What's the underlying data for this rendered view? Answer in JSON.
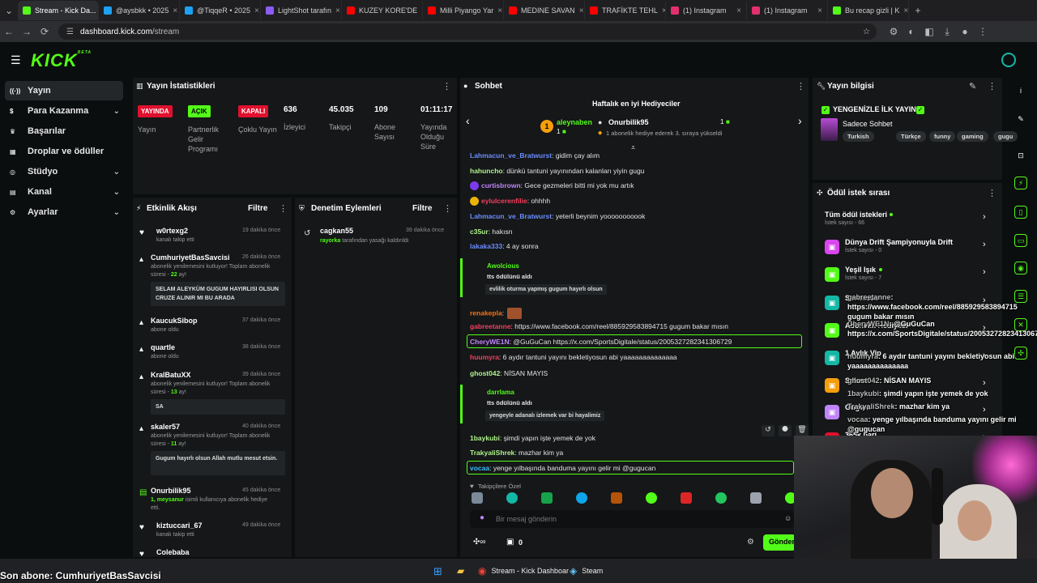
{
  "browser": {
    "tabs": [
      {
        "title": "Stream - Kick Da...",
        "color": "#53fc18",
        "active": true
      },
      {
        "title": "@aysbkk • 2025",
        "color": "#1da1f2"
      },
      {
        "title": "@TiqqeR • 2025",
        "color": "#1da1f2"
      },
      {
        "title": "LightShot tarafın",
        "color": "#8b5cf6"
      },
      {
        "title": "KUZEY KORE'DE",
        "color": "#ff0000"
      },
      {
        "title": "Milli Piyango Yar",
        "color": "#ff0000"
      },
      {
        "title": "MEDINE SAVAN",
        "color": "#ff0000"
      },
      {
        "title": "TRAFİKTE TEHL",
        "color": "#ff0000"
      },
      {
        "title": "(1) Instagram",
        "color": "#e1306c"
      },
      {
        "title": "(1) Instagram",
        "color": "#e1306c"
      },
      {
        "title": "Bu recap gizli | K",
        "color": "#53fc18"
      }
    ],
    "url_host": "dashboard.kick.com",
    "url_path": "/stream"
  },
  "header": {
    "logo": "KICK",
    "logo_badge": "BETA"
  },
  "sidebar": {
    "items": [
      {
        "label": "Yayın",
        "icon": "radio-icon",
        "active": true
      },
      {
        "label": "Para Kazanma",
        "icon": "money-icon",
        "chevron": true
      },
      {
        "label": "Başarılar",
        "icon": "trophy-icon"
      },
      {
        "label": "Droplar ve ödüller",
        "icon": "gift-icon"
      },
      {
        "label": "Stüdyo",
        "icon": "studio-icon",
        "chevron": true
      },
      {
        "label": "Kanal",
        "icon": "channel-icon",
        "chevron": true
      },
      {
        "label": "Ayarlar",
        "icon": "gear-icon",
        "chevron": true
      }
    ]
  },
  "stats": {
    "title": "Yayın İstatistikleri",
    "badges": [
      {
        "badge": "YAYINDA",
        "label": "Yayın",
        "bg": "#e0102e",
        "fg": "#ffffff"
      },
      {
        "badge": "AÇIK",
        "label": "Partnerlik Gelir Programı",
        "bg": "#53fc18",
        "fg": "#000000"
      },
      {
        "badge": "KAPALI",
        "label": "Çoklu Yayın",
        "bg": "#e0102e",
        "fg": "#ffffff"
      }
    ],
    "numbers": [
      {
        "value": "636",
        "label": "İzleyici"
      },
      {
        "value": "45.035",
        "label": "Takipçi"
      },
      {
        "value": "109",
        "label": "Abone Sayısı"
      },
      {
        "value": "01:11:17",
        "label": "Yayında Olduğu Süre"
      }
    ]
  },
  "activity": {
    "title": "Etkinlik Akışı",
    "filter": "Filtre",
    "items": [
      {
        "name": "w0rtexg2",
        "sub": "kanalı takip etti",
        "time": "19 dakika önce",
        "icon": "heart-icon"
      },
      {
        "name": "CumhuriyetBasSavcisi",
        "sub": "abonelik yenilemesini kutluyor! Toplam abonelik süresi - ",
        "sub_hl": "22",
        "sub_end": " ay!",
        "time": "26 dakika önce",
        "icon": "star-icon",
        "message": "SELAM ALEYKÜM GUGUM HAYIRLISI OLSUN CRUZE ALINIR MI BU ARADA"
      },
      {
        "name": "KaucukSibop",
        "sub": "abone oldu",
        "time": "37 dakika önce",
        "icon": "star-icon"
      },
      {
        "name": "quartle",
        "sub": "abone oldu",
        "time": "38 dakika önce",
        "icon": "star-icon"
      },
      {
        "name": "KralBatuXX",
        "sub": "abonelik yenilemesini kutluyor! Toplam abonelik süresi - ",
        "sub_hl": "13",
        "sub_end": " ay!",
        "time": "39 dakika önce",
        "icon": "star-icon",
        "message": "SA"
      },
      {
        "name": "skaler57",
        "sub": "abonelik yenilemesini kutluyor! Toplam abonelik süresi - ",
        "sub_hl": "11",
        "sub_end": " ay!",
        "time": "40 dakika önce",
        "icon": "star-icon",
        "message": "Gugum hayırlı olsun Allah mutlu mesut etsin."
      },
      {
        "name": "Onurbilik95",
        "sub_pre": "1, ",
        "sub_user": "meysanur",
        "sub": " isimli kullanıcıya abonelik hediye etti.",
        "time": "45 dakika önce",
        "icon": "gift-icon"
      },
      {
        "name": "kiztuccari_67",
        "sub": "kanalı takip etti",
        "time": "49 dakika önce",
        "icon": "heart-icon"
      },
      {
        "name": "Colebaba",
        "sub": "",
        "time": "",
        "icon": "heart-icon"
      }
    ]
  },
  "moderation": {
    "title": "Denetim Eylemleri",
    "filter": "Filtre",
    "items": [
      {
        "name": "cagkan55",
        "by": "rayorka",
        "action": " tarafından yasağı kaldırıldı",
        "time": "39 dakika önce"
      }
    ]
  },
  "chat": {
    "title": "Sohbet",
    "top_gifters_title": "Haftalık en iyi Hediyeciler",
    "gifter1": {
      "rank": "1",
      "name": "aleynaben",
      "count": "1"
    },
    "gifter2": {
      "name": "Onurbilik95",
      "count": "1",
      "note": "1 abonelik hediye ederek 3. sıraya yükseldi"
    },
    "messages": [
      {
        "user": "Lahmacun_ve_Bratwurst",
        "color": "#6b8cff",
        "text": ": gidim çay alım"
      },
      {
        "user": "hahuncho",
        "color": "#aef28a",
        "text": ": dünkü tantuni yayınından kalanları yiyin gugu"
      },
      {
        "user": "curtisbrown",
        "color": "#c084fc",
        "text": ": Gece gezmeleri bitti mi yok mu artık"
      },
      {
        "user": "eylulcerenfilie",
        "color": "#f43f5e",
        "text": ": ohhhh"
      },
      {
        "user": "Lahmacun_ve_Bratwurst",
        "color": "#6b8cff",
        "text": ": yeterli beynim yooooooooook"
      },
      {
        "user": "c35ur",
        "color": "#aef28a",
        "text": ": hakısn"
      },
      {
        "user": "lakaka333",
        "color": "#6b8cff",
        "text": ": 4 ay sonra"
      },
      {
        "user": "Awolcious",
        "color": "#53fc18",
        "text": "tts ödülünü aldı",
        "tts": "evlilik oturma yapmış gugum hayırlı olsun"
      },
      {
        "user": "renakepla",
        "color": "#f97316",
        "text": ":"
      },
      {
        "user": "gabreetanne",
        "color": "#f43f5e",
        "text": ": https://www.facebook.com/reel/885929583894715 gugum bakar mısın"
      },
      {
        "user": "CheryWE1N",
        "color": "#c084fc",
        "text": ": @GuGuCan https://x.com/SportsDigitale/status/2005327282341306729"
      },
      {
        "user": "huumyra",
        "color": "#f43f5e",
        "text": ": 6 aydır tantuni yayını bekletiyosun abi yaaaaaaaaaaaaaa"
      },
      {
        "user": "ghost042",
        "color": "#aef28a",
        "text": ": NİSAN MAYIS"
      },
      {
        "user": "darrlama",
        "color": "#53fc18",
        "text": "tts ödülünü aldı",
        "tts": "yengeyle adanalı izlemek var bi hayalimiz"
      },
      {
        "user": "1baykubi",
        "color": "#aef28a",
        "text": ": şimdi yapın işte yemek de yok"
      },
      {
        "user": "TrakyaliShrek",
        "color": "#aef28a",
        "text": ": mazhar kim ya"
      },
      {
        "user": "vocaa",
        "color": "#38bdf8",
        "text": ": yenge yılbaşında banduma yayını gelir mi @gugucan"
      }
    ],
    "followers_only": "Takipçilere Özel",
    "input_placeholder": "Bir mesaj gönderin",
    "points": "0",
    "send": "Gönder"
  },
  "stream_info": {
    "title": "Yayın bilgisi",
    "stream_title": "YENGENİZLE İLK YAYIN",
    "category": "Sadece Sohbet",
    "tags": [
      "Turkish",
      "Türkçe",
      "funny",
      "gaming",
      "gugu"
    ]
  },
  "rewards": {
    "title": "Ödül istek sırası",
    "items": [
      {
        "title": "Tüm ödül istekleri",
        "sub": "İstek sayısı - 66",
        "icon_color": "",
        "dot": true
      },
      {
        "title": "Dünya Drift Şampiyonuyla Drift",
        "sub": "İstek sayısı - 0",
        "icon_color": "#d946ef"
      },
      {
        "title": "Yeşil Işık",
        "sub": "İstek sayısı - 7",
        "icon_color": "#53fc18",
        "dot": true
      },
      {
        "title": "Sorunsuz",
        "sub": "",
        "icon_color": "#14b8a6"
      },
      {
        "title": "Abonelik Hediyesi",
        "sub": "",
        "icon_color": "#53fc18"
      },
      {
        "title": "1 Aylık Vip",
        "sub": "",
        "icon_color": "#14b8a6"
      },
      {
        "title": "Selam",
        "sub": "",
        "icon_color": "#f59e0b"
      },
      {
        "title": "Gugum",
        "sub": "",
        "icon_color": "#c084fc"
      },
      {
        "title": "365k bari",
        "sub": "",
        "icon_color": "#e0102e"
      }
    ]
  },
  "overlay_chat": [
    {
      "user": "gabreetanne",
      "text": ": https://www.facebook.com/reel/885929583894715 gugum bakar mısın"
    },
    {
      "user": "CheryWE1N",
      "text": ": @GuGuCan https://x.com/SportsDigitale/status/2005327282341306729"
    },
    {
      "user": "huumyra",
      "text": ": 6 aydır tantuni yayını bekletiyosun abi yaaaaaaaaaaaaaa"
    },
    {
      "user": "ghost042",
      "text": ": NİSAN MAYIS"
    },
    {
      "user": "1baykubi",
      "text": ": şimdi yapın işte yemek de yok"
    },
    {
      "user": "TrakyaliShrek",
      "text": ": mazhar kim ya"
    },
    {
      "user": "vocaa",
      "text": ": yenge yılbaşında banduma yayını gelir mi @gugucan"
    }
  ],
  "ticker": "Son abone: CumhuriyetBasSavcisi",
  "taskbar": {
    "items": [
      {
        "label": "Stream - Kick Dashboar"
      },
      {
        "label": "Steam"
      }
    ]
  }
}
